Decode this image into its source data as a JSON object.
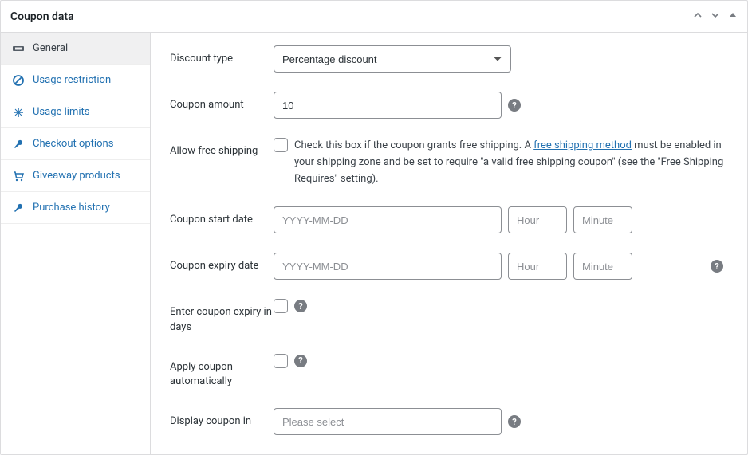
{
  "panel": {
    "title": "Coupon data"
  },
  "sidebar": {
    "items": [
      {
        "label": "General",
        "icon": "ticket"
      },
      {
        "label": "Usage restriction",
        "icon": "ban"
      },
      {
        "label": "Usage limits",
        "icon": "stats"
      },
      {
        "label": "Checkout options",
        "icon": "wrench"
      },
      {
        "label": "Giveaway products",
        "icon": "cart"
      },
      {
        "label": "Purchase history",
        "icon": "wrench"
      }
    ]
  },
  "form": {
    "discount_type": {
      "label": "Discount type",
      "value": "Percentage discount"
    },
    "coupon_amount": {
      "label": "Coupon amount",
      "value": "10"
    },
    "free_shipping": {
      "label": "Allow free shipping",
      "desc_pre": "Check this box if the coupon grants free shipping. A ",
      "desc_link": "free shipping method",
      "desc_post": " must be enabled in your shipping zone and be set to require \"a valid free shipping coupon\" (see the \"Free Shipping Requires\" setting)."
    },
    "start_date": {
      "label": "Coupon start date",
      "date_ph": "YYYY-MM-DD",
      "hour_ph": "Hour",
      "minute_ph": "Minute"
    },
    "expiry_date": {
      "label": "Coupon expiry date",
      "date_ph": "YYYY-MM-DD",
      "hour_ph": "Hour",
      "minute_ph": "Minute"
    },
    "expiry_days": {
      "label": "Enter coupon expiry in days"
    },
    "auto_apply": {
      "label": "Apply coupon automatically"
    },
    "display_in": {
      "label": "Display coupon in",
      "placeholder": "Please select"
    }
  }
}
